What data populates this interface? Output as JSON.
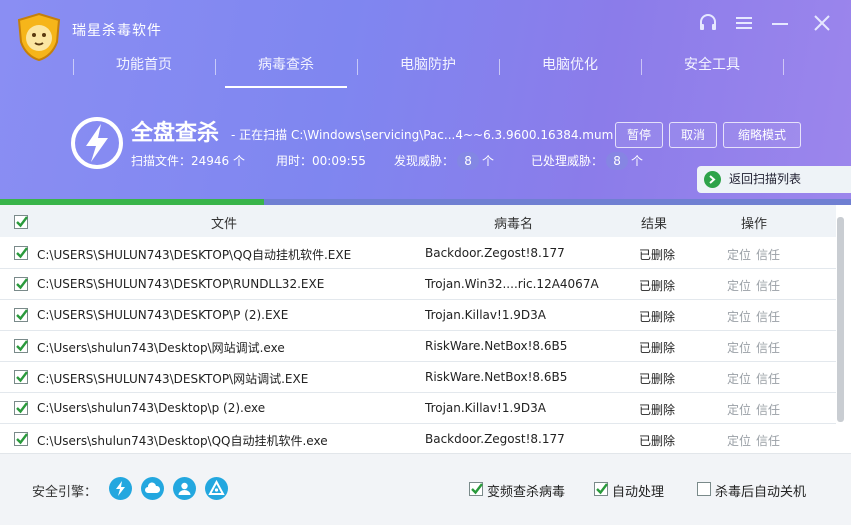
{
  "app": {
    "title": "瑞星杀毒软件"
  },
  "nav": {
    "items": [
      {
        "label": "功能首页",
        "active": false
      },
      {
        "label": "病毒查杀",
        "active": true
      },
      {
        "label": "电脑防护",
        "active": false
      },
      {
        "label": "电脑优化",
        "active": false
      },
      {
        "label": "安全工具",
        "active": false
      }
    ]
  },
  "scan": {
    "title": "全盘查杀",
    "status": "- 正在扫描 C:\\Windows\\servicing\\Pac...4~~6.3.9600.16384.mum",
    "files_label": "扫描文件：",
    "files_value": "24946",
    "files_unit": "个",
    "time_label": "用时：",
    "time_value": "00:09:55",
    "threats_label": "发现威胁：",
    "threats_value": "8",
    "threats_unit": "个",
    "handled_label": "已处理威胁：",
    "handled_value": "8",
    "handled_unit": "个",
    "pause_label": "暂停",
    "cancel_label": "取消",
    "minimize_label": "缩略模式",
    "back_label": "返回扫描列表",
    "progress_percent": 31
  },
  "table": {
    "headers": {
      "file": "文件",
      "virus": "病毒名",
      "result": "结果",
      "ops": "操作"
    },
    "rows": [
      {
        "file": "C:\\USERS\\SHULUN743\\DESKTOP\\QQ自动挂机软件.EXE",
        "virus": "Backdoor.Zegost!8.177",
        "result": "已删除",
        "locate": "定位",
        "trust": "信任"
      },
      {
        "file": "C:\\USERS\\SHULUN743\\DESKTOP\\RUNDLL32.EXE",
        "virus": "Trojan.Win32....ric.12A4067A",
        "result": "已删除",
        "locate": "定位",
        "trust": "信任"
      },
      {
        "file": "C:\\USERS\\SHULUN743\\DESKTOP\\P (2).EXE",
        "virus": "Trojan.Killav!1.9D3A",
        "result": "已删除",
        "locate": "定位",
        "trust": "信任"
      },
      {
        "file": "C:\\Users\\shulun743\\Desktop\\网站调试.exe",
        "virus": "RiskWare.NetBox!8.6B5",
        "result": "已删除",
        "locate": "定位",
        "trust": "信任"
      },
      {
        "file": "C:\\USERS\\SHULUN743\\DESKTOP\\网站调试.EXE",
        "virus": "RiskWare.NetBox!8.6B5",
        "result": "已删除",
        "locate": "定位",
        "trust": "信任"
      },
      {
        "file": "C:\\Users\\shulun743\\Desktop\\p (2).exe",
        "virus": "Trojan.Killav!1.9D3A",
        "result": "已删除",
        "locate": "定位",
        "trust": "信任"
      },
      {
        "file": "C:\\Users\\shulun743\\Desktop\\QQ自动挂机软件.exe",
        "virus": "Backdoor.Zegost!8.177",
        "result": "已删除",
        "locate": "定位",
        "trust": "信任"
      }
    ]
  },
  "footer": {
    "engines_label": "安全引擎：",
    "engine_icons": [
      "lightning-icon",
      "cloud-icon",
      "user-icon",
      "triangle-icon"
    ],
    "options": [
      {
        "label": "变频查杀病毒",
        "checked": true
      },
      {
        "label": "自动处理",
        "checked": true
      },
      {
        "label": "杀毒后自动关机",
        "checked": false
      }
    ]
  },
  "colors": {
    "header": "#8a8ef3",
    "accent_green": "#39b44a",
    "engine_blue": "#23a7df"
  }
}
